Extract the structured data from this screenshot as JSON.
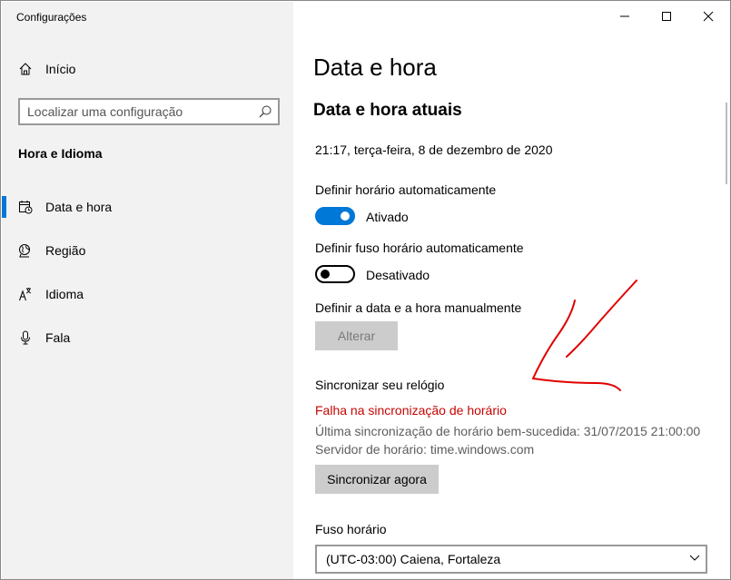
{
  "window": {
    "title": "Configurações"
  },
  "sidebar": {
    "home_label": "Início",
    "search_placeholder": "Localizar uma configuração",
    "section_title": "Hora e Idioma",
    "items": [
      {
        "label": "Data e hora",
        "icon": "calendar-clock-icon",
        "active": true
      },
      {
        "label": "Região",
        "icon": "globe-icon",
        "active": false
      },
      {
        "label": "Idioma",
        "icon": "language-icon",
        "active": false
      },
      {
        "label": "Fala",
        "icon": "microphone-icon",
        "active": false
      }
    ]
  },
  "main": {
    "title": "Data e hora",
    "subheading": "Data e hora atuais",
    "current_datetime": "21:17, terça-feira, 8 de dezembro de 2020",
    "auto_time": {
      "label": "Definir horário automaticamente",
      "state": "Ativado",
      "on": true
    },
    "auto_timezone": {
      "label": "Definir fuso horário automaticamente",
      "state": "Desativado",
      "on": false
    },
    "manual": {
      "label": "Definir a data e a hora manualmente",
      "button": "Alterar",
      "disabled": true
    },
    "sync": {
      "title": "Sincronizar seu relógio",
      "error": "Falha na sincronização de horário",
      "last_sync": "Última sincronização de horário bem-sucedida: 31/07/2015 21:00:00",
      "server": "Servidor de horário: time.windows.com",
      "button": "Sincronizar agora"
    },
    "timezone": {
      "label": "Fuso horário",
      "value": "(UTC-03:00) Caiena, Fortaleza"
    }
  },
  "colors": {
    "accent": "#0078d7",
    "error": "#c50500",
    "annotation": "#e00000"
  }
}
